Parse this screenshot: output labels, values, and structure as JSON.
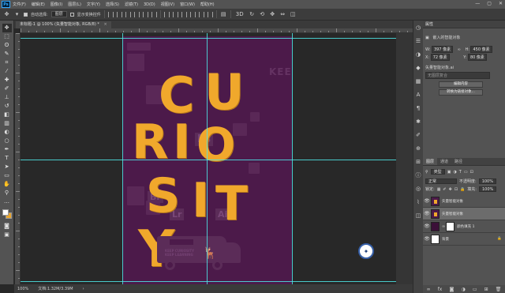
{
  "menubar": {
    "logo": "Ps",
    "items": [
      "文件(F)",
      "编辑(E)",
      "图像(I)",
      "图层(L)",
      "文字(Y)",
      "选择(S)",
      "滤镜(T)",
      "3D(D)",
      "视图(V)",
      "窗口(W)",
      "帮助(H)"
    ],
    "window_controls": [
      "—",
      "▢",
      "✕"
    ]
  },
  "options": {
    "auto_select_label": "自动选择:",
    "auto_select_value": "图层",
    "show_transform_label": "显示变换控件"
  },
  "document": {
    "tab_label": "未标题-1 @ 100% (矢量智能对象, RGB/8) *",
    "close": "×"
  },
  "artwork": {
    "letters": [
      "C",
      "U",
      "R",
      "I",
      "O",
      "S",
      "I",
      "T",
      "Y"
    ],
    "bg_words": [
      "KEEP",
      "Ps",
      "Br",
      "Lr",
      "Ai"
    ],
    "van_text_line1": "KEEP CURIOSITY",
    "van_text_line2": "KEEP LEARNING"
  },
  "statusbar": {
    "zoom": "100%",
    "doc_info": "文档:1.32M/3.39M"
  },
  "properties": {
    "title": "属性",
    "object_label": "嵌入的智能对象",
    "w_label": "W:",
    "w_value": "397 像素",
    "h_label": "H:",
    "h_value": "450 像素",
    "x_label": "X:",
    "x_value": "72 像素",
    "y_label": "Y:",
    "y_value": "80 像素",
    "layer_comp_label": "矢量智能对象.ai",
    "layer_comp_placeholder": "无图层复合",
    "edit_contents_btn": "编辑内容",
    "convert_btn": "转换为链接对象..."
  },
  "layers": {
    "tabs": [
      "图层",
      "通道",
      "路径"
    ],
    "filter_label": "类型",
    "blend_mode": "正常",
    "opacity_label": "不透明度:",
    "opacity_value": "100%",
    "lock_label": "锁定:",
    "fill_label": "填充:",
    "fill_value": "100%",
    "rows": [
      {
        "name": "矢量智能对象",
        "selected": false
      },
      {
        "name": "矢量智能对象",
        "selected": true
      },
      {
        "name": "颜色填充 1",
        "selected": false
      },
      {
        "name": "背景",
        "selected": false
      }
    ],
    "footer_icons": [
      "link-icon",
      "fx-icon",
      "mask-icon",
      "adjustment-icon",
      "folder-icon",
      "new-layer-icon",
      "trash-icon"
    ]
  },
  "colors": {
    "canvas_bg": "#4c1a4a",
    "letter": "#f0a82c",
    "guide": "#4ee6e6"
  }
}
